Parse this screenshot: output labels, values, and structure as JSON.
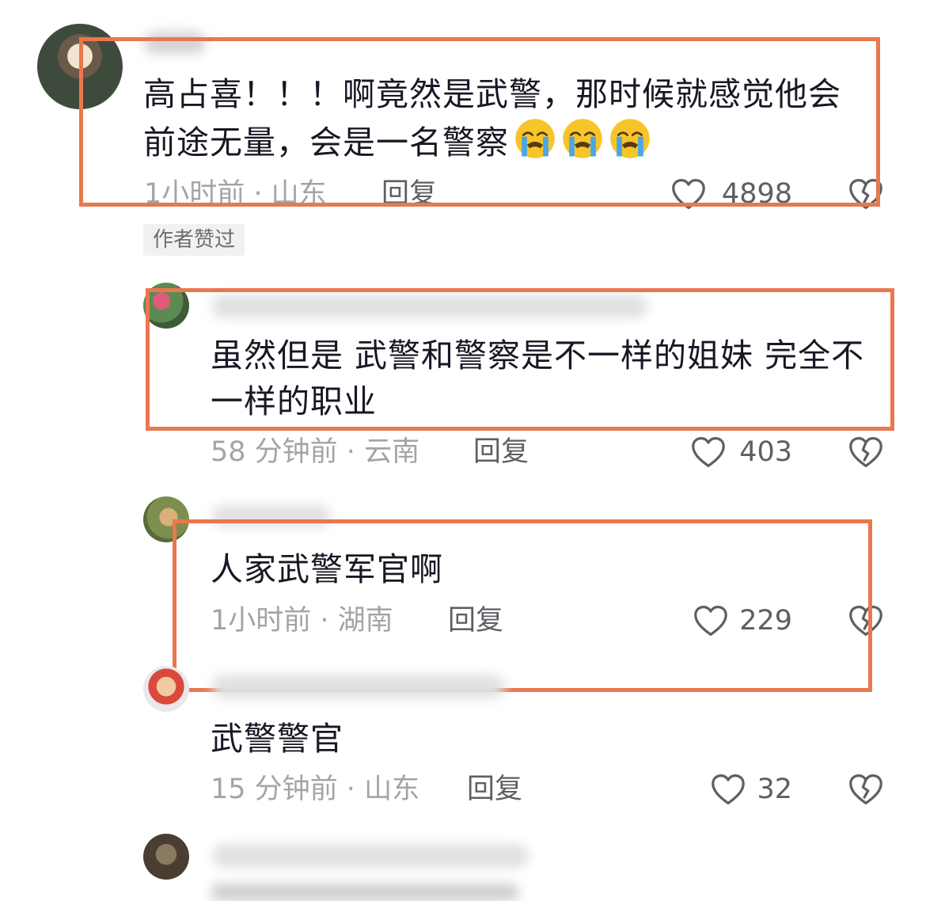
{
  "colors": {
    "highlight_frame": "#e8784d",
    "meta_text": "#a4a4a8",
    "action_text": "#5e5e63",
    "body_text": "#161823"
  },
  "comments": [
    {
      "text": "高占喜！！！啊竟然是武警，那时候就感觉他会前途无量，会是一名警察",
      "emoji": "loudly-crying-face",
      "time": "1小时前",
      "location": "山东",
      "reply_label": "回复",
      "likes": "4898",
      "badge": "作者赞过"
    },
    {
      "text": "虽然但是 武警和警察是不一样的姐妹 完全不一样的职业",
      "time": "58 分钟前",
      "location": "云南",
      "reply_label": "回复",
      "likes": "403"
    },
    {
      "text": "人家武警军官啊",
      "time": "1小时前",
      "location": "湖南",
      "reply_label": "回复",
      "likes": "229"
    },
    {
      "text": "武警警官",
      "time": "15 分钟前",
      "location": "山东",
      "reply_label": "回复",
      "likes": "32"
    }
  ],
  "icons": {
    "like": "heart-outline-icon",
    "dislike": "broken-heart-icon"
  }
}
